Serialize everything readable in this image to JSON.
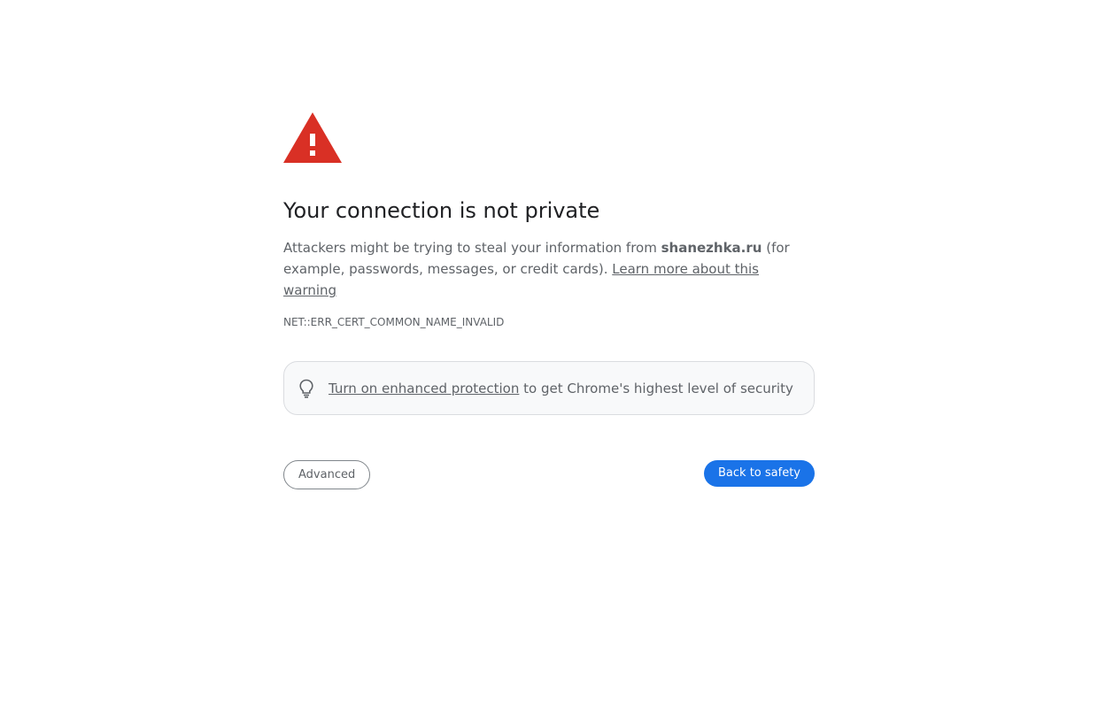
{
  "icons": {
    "warning": "warning-triangle-icon",
    "promo": "lightbulb-icon"
  },
  "colors": {
    "warning_red": "#d93025",
    "accent_blue": "#1a73e8",
    "text_secondary": "#5f6368"
  },
  "heading": "Your connection is not private",
  "explanation": {
    "prefix": "Attackers might be trying to steal your information from ",
    "host": "shanezhka.ru",
    "suffix": " (for example, passwords, messages, or credit cards). ",
    "learn_more": "Learn more about this warning"
  },
  "error_code": "NET::ERR_CERT_COMMON_NAME_INVALID",
  "promo": {
    "link_text": "Turn on enhanced protection",
    "rest_text": " to get Chrome's highest level of security"
  },
  "buttons": {
    "advanced": "Advanced",
    "back_to_safety": "Back to safety"
  }
}
